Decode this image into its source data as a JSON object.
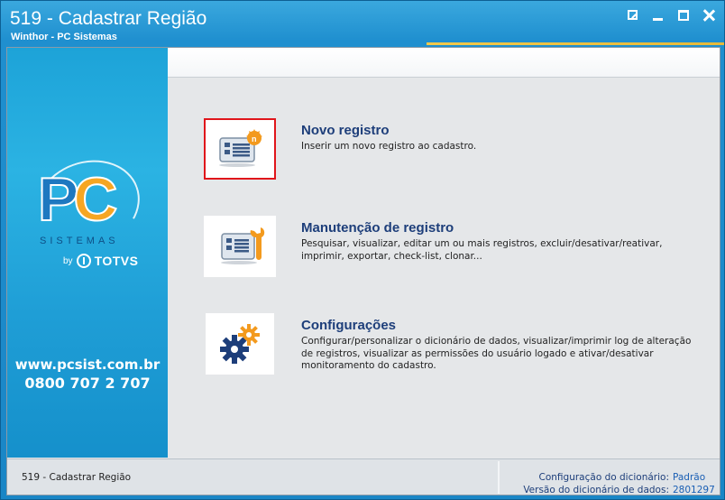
{
  "window": {
    "title": "519 - Cadastrar Região",
    "subtitle": "Winthor - PC Sistemas"
  },
  "sidebar": {
    "logo_text": "PC",
    "logo_sub": "SISTEMAS",
    "logo_by": "by",
    "logo_brand": "TOTVS",
    "url": "www.pcsist.com.br",
    "phone": "0800 707 2 707"
  },
  "actions": [
    {
      "title": "Novo registro",
      "description": "Inserir um novo registro ao cadastro.",
      "icon": "new-record-icon"
    },
    {
      "title": "Manutenção de registro",
      "description": "Pesquisar, visualizar, editar um ou mais registros, excluir/desativar/reativar, imprimir, exportar, check-list,  clonar...",
      "icon": "maintenance-icon"
    },
    {
      "title": "Configurações",
      "description": "Configurar/personalizar o dicionário de dados, visualizar/imprimir log de alteração de registros, visualizar as permissões do usuário logado e ativar/desativar monitoramento do cadastro.",
      "icon": "settings-gears-icon"
    }
  ],
  "statusbar": {
    "left": "519 - Cadastrar Região",
    "config_label": "Configuração do dicionário:",
    "config_value": "Padrão",
    "version_label": "Versão do dicionário de dados:",
    "version_value": "2801297"
  },
  "colors": {
    "titlebar": "#1f8fcf",
    "accent": "#f2c84b",
    "action_title": "#1d3e7a",
    "selection": "#e0161b"
  }
}
